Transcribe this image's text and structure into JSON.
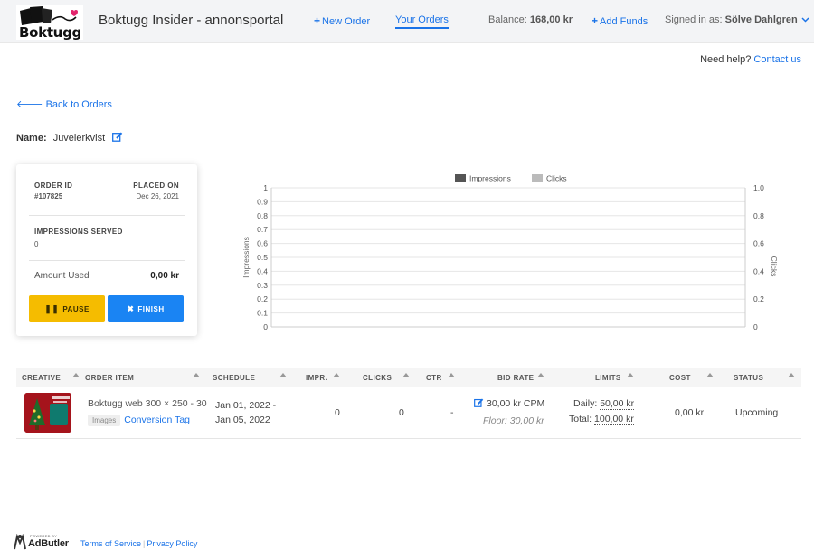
{
  "header": {
    "logo_text": "Boktugg",
    "title": "Boktugg Insider - annonsportal",
    "nav_new_order": "New Order",
    "nav_your_orders": "Your Orders",
    "balance_label": "Balance:",
    "balance_value": "168,00 kr",
    "add_funds": "Add Funds",
    "signed_in_label": "Signed in as:",
    "signed_in_user": "Sölve Dahlgren"
  },
  "help": {
    "text": "Need help?",
    "link": "Contact us"
  },
  "back_link": "Back to Orders",
  "order_name": {
    "label": "Name:",
    "value": "Juvelerkvist"
  },
  "order_card": {
    "order_id_label": "ORDER ID",
    "order_id": "#107825",
    "placed_on_label": "PLACED ON",
    "placed_on": "Dec 26, 2021",
    "impressions_label": "IMPRESSIONS SERVED",
    "impressions": "0",
    "amount_used_label": "Amount Used",
    "amount_used": "0,00 kr",
    "pause_label": "PAUSE",
    "finish_label": "FINISH"
  },
  "chart_data": {
    "type": "line",
    "x": [],
    "series": [
      {
        "name": "Impressions",
        "values": [],
        "color": "#555555"
      },
      {
        "name": "Clicks",
        "values": [],
        "color": "#bbbbbb"
      }
    ],
    "ylabel": "Impressions",
    "y2label": "Clicks",
    "ylim": [
      0,
      1
    ],
    "y2lim": [
      0,
      1
    ],
    "yticks": [
      "0",
      "0.1",
      "0.2",
      "0.3",
      "0.4",
      "0.5",
      "0.6",
      "0.7",
      "0.8",
      "0.9",
      "1"
    ],
    "y2ticks": [
      "0",
      "0.2",
      "0.4",
      "0.6",
      "0.8",
      "1.0"
    ],
    "grid": true,
    "legend": "top-center"
  },
  "table": {
    "headers": [
      "CREATIVE",
      "ORDER ITEM",
      "SCHEDULE",
      "IMPR.",
      "CLICKS",
      "CTR",
      "BID RATE",
      "LIMITS",
      "COST",
      "STATUS"
    ],
    "rows": [
      {
        "item_name": "Boktugg web 300 × 250 - 30",
        "item_tag": "Images",
        "item_link": "Conversion Tag",
        "schedule_start": "Jan 01, 2022 -",
        "schedule_end": "Jan 05, 2022",
        "impressions": "0",
        "clicks": "0",
        "ctr": "-",
        "bid_rate": "30,00 kr CPM",
        "floor": "Floor: 30,00 kr",
        "daily_label": "Daily:",
        "daily_value": "50,00 kr",
        "total_label": "Total:",
        "total_value": "100,00 kr",
        "cost": "0,00 kr",
        "status": "Upcoming"
      }
    ]
  },
  "footer": {
    "powered_by": "POWERED BY",
    "brand": "AdButler",
    "terms": "Terms of Service",
    "privacy": "Privacy Policy"
  },
  "colors": {
    "accent": "#1a73e8",
    "pause": "#f5bc00",
    "finish": "#1a84f3"
  }
}
